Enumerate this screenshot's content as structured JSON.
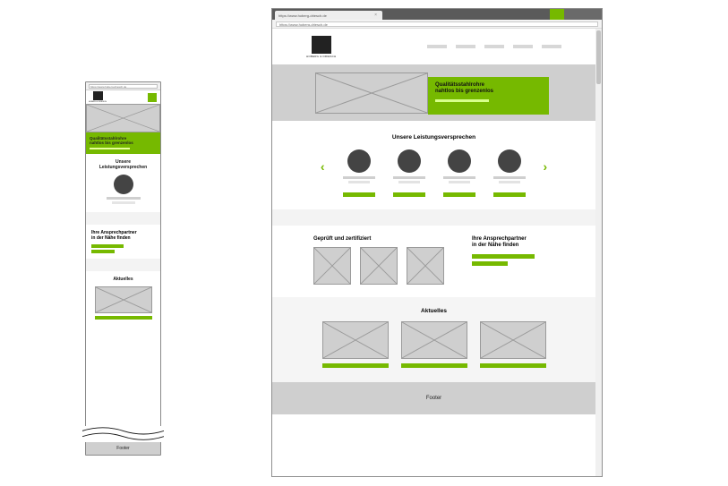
{
  "url": "https://www.hoberg-driesch.de",
  "tab_title": "https://www.hoberg-driesch.de",
  "brand": "HOBERG & DRIESCH",
  "hero": {
    "line1": "Qualitätsstahlrohre",
    "line2": "nahtlos bis grenzenlos"
  },
  "section_services": {
    "heading": "Unsere Leistungsversprechen"
  },
  "section_contact": {
    "heading_line1": "Ihre Ansprechpartner",
    "heading_line2": "in der Nähe finden"
  },
  "section_certified": {
    "heading": "Geprüft und zertifiziert"
  },
  "section_news": {
    "heading": "Aktuelles"
  },
  "footer": "Footer"
}
